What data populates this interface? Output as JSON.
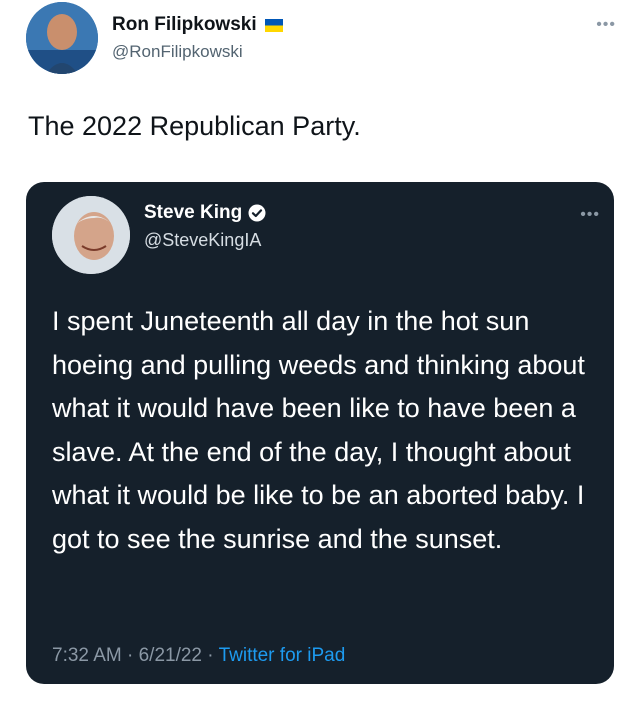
{
  "tweet": {
    "author": {
      "display_name": "Ron Filipkowski",
      "handle": "@RonFilipkowski",
      "flag_icon": "ukraine-flag-icon"
    },
    "more_label": "•••",
    "text": "The 2022 Republican Party."
  },
  "quoted": {
    "author": {
      "display_name": "Steve King",
      "handle": "@SteveKingIA",
      "badge": "verified-badge-icon"
    },
    "more_label": "•••",
    "body": "I spent Juneteenth all day in the hot sun hoeing and pulling weeds and thinking about what it would have been like to have been a slave. At the end of the day, I thought about what it would be like to be an aborted baby. I got to see the sunrise and the sunset.",
    "time": "7:32 AM",
    "sep": " · ",
    "date": "6/21/22",
    "source": "Twitter for iPad"
  },
  "colors": {
    "card_bg": "#15202b",
    "link": "#1d9bf0",
    "flag_blue": "#0057b7",
    "flag_yellow": "#ffd700"
  }
}
